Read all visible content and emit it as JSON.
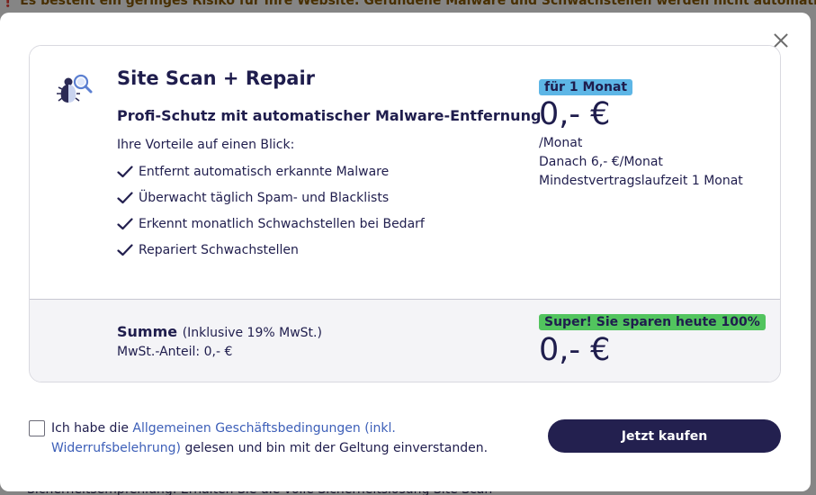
{
  "background": {
    "banner_text": "❗ Es besteht ein geringes Risiko für Ihre Website: Gefundene Malware und Schwachstellen werden nicht automatisch repariert.",
    "footer_text": "Sicherheitsempfehlung: Erhalten Sie die volle Sicherheitslösung Site Scan"
  },
  "product": {
    "title": "Site Scan + Repair",
    "subtitle": "Profi-Schutz mit automatischer Malware-Entfernung",
    "benefits_heading": "Ihre Vorteile auf einen Blick:",
    "benefits": [
      "Entfernt automatisch erkannte Malware",
      "Überwacht täglich Spam- und Blacklists",
      "Erkennt monatlich Schwachstellen bei Bedarf",
      "Repariert Schwachstellen"
    ]
  },
  "pricing": {
    "period_badge": "für 1 Monat",
    "price": "0,- €",
    "per_month": "/Monat",
    "after_price": "Danach 6,- €/Monat",
    "min_term": "Mindestvertragslaufzeit 1 Monat"
  },
  "summary": {
    "label": "Summe",
    "vat_note": "(Inklusive 19% MwSt.)",
    "vat_line": "MwSt.-Anteil: 0,- €",
    "save_badge": "Super! Sie sparen heute 100%",
    "total": "0,- €"
  },
  "terms": {
    "prefix": "Ich habe die ",
    "link": "Allgemeinen Geschäftsbedingungen (inkl. Widerrufsbelehrung)",
    "suffix": " gelesen und bin mit der Geltung einverstanden.",
    "checked": false
  },
  "buy_button": "Jetzt kaufen",
  "icons": {
    "close": "close-icon",
    "product": "bug-magnifier-icon",
    "check": "check-icon"
  },
  "colors": {
    "primary": "#23204f",
    "period_badge": "#5db6e6",
    "save_badge": "#52c45e",
    "link": "#3d5fb8"
  }
}
